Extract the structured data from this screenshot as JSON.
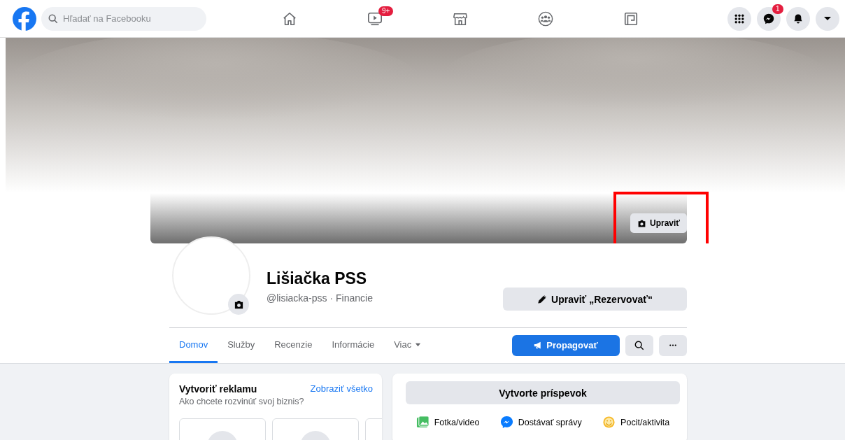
{
  "topbar": {
    "search": {
      "placeholder": "Hľadať na Facebooku"
    },
    "video_badge": "9+",
    "messenger_badge": "1"
  },
  "cover": {
    "edit_button": "Upraviť"
  },
  "profile": {
    "name": "Lišiačka PSS",
    "subtitle": "@lisiacka-pss · Financie",
    "edit_button": "Upraviť „Rezervovať“"
  },
  "tabs": [
    {
      "label": "Domov",
      "selected": true,
      "kind": "link"
    },
    {
      "label": "Služby",
      "selected": false,
      "kind": "link"
    },
    {
      "label": "Recenzie",
      "selected": false,
      "kind": "link"
    },
    {
      "label": "Informácie",
      "selected": false,
      "kind": "link"
    },
    {
      "label": "Viac",
      "selected": false,
      "kind": "dropdown"
    }
  ],
  "tab_actions": {
    "promote": "Propagovať"
  },
  "ad_card": {
    "title": "Vytvoriť reklamu",
    "link": "Zobraziť všetko",
    "subtitle": "Ako chcete rozvinúť svoj biznis?"
  },
  "post_card": {
    "button": "Vytvorte príspevok",
    "options": [
      "Fotka/video",
      "Dostávať správy",
      "Pocit/aktivita"
    ]
  }
}
